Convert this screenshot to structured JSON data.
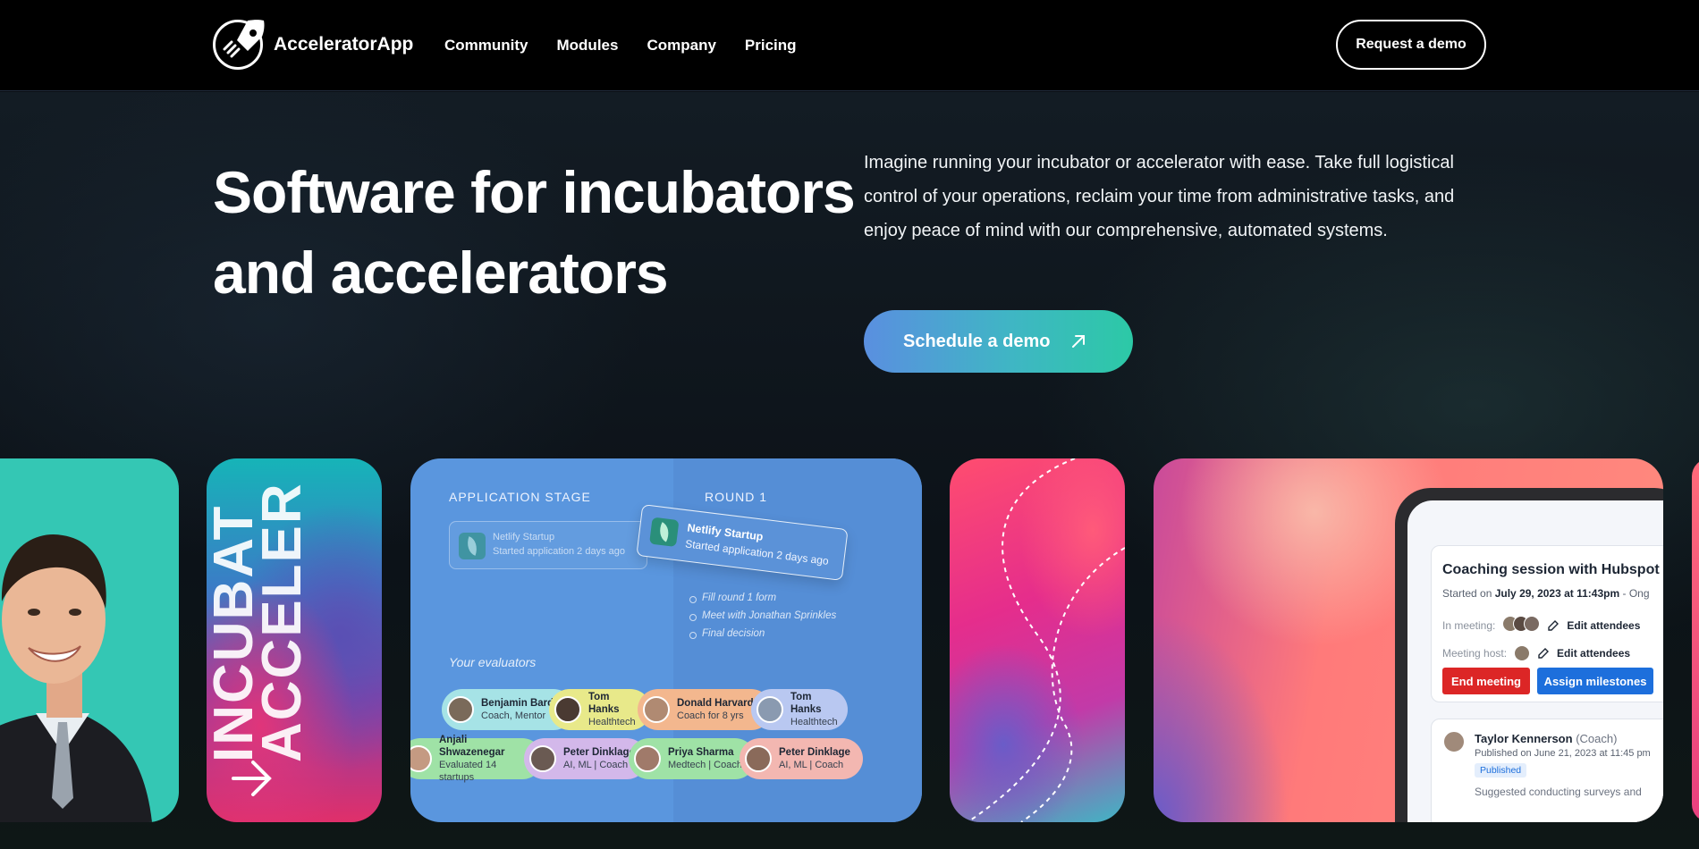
{
  "nav": {
    "brand": "AcceleratorApp",
    "links": [
      "Community",
      "Modules",
      "Company",
      "Pricing"
    ],
    "cta": "Request a demo"
  },
  "hero": {
    "title": "Software for incubators and accelerators",
    "description": "Imagine running your incubator or accelerator with ease. Take full logistical control of your operations, reclaim your time from administrative tasks, and enjoy peace of mind with our comprehensive, automated systems.",
    "cta": "Schedule a demo"
  },
  "cards": {
    "incubator": {
      "line1": "INCUBAT",
      "line2": "ACCELER"
    },
    "application": {
      "stage_label": "APPLICATION STAGE",
      "round_label": "ROUND 1",
      "tile_name": "Netlify Startup",
      "tile_sub": "Started application 2 days ago",
      "checklist": [
        "Fill round 1 form",
        "Meet with Jonathan Sprinkles",
        "Final decision"
      ],
      "evaluators_label": "Your evaluators",
      "evaluators": [
        {
          "name": "Benjamin Bard",
          "sub": "Coach, Mentor",
          "color": "#a6e3e6"
        },
        {
          "name": "Tom Hanks",
          "sub": "Healthtech",
          "color": "#e8e98a"
        },
        {
          "name": "Donald Harvard",
          "sub": "Coach for 8 yrs",
          "color": "#f3b78e"
        },
        {
          "name": "Tom Hanks",
          "sub": "Healthtech",
          "color": "#b9c8f1"
        },
        {
          "name": "Anjali Shwazenegar",
          "sub": "Evaluated 14 startups",
          "color": "#9fe2a6"
        },
        {
          "name": "Peter Dinklage",
          "sub": "AI, ML | Coach",
          "color": "#d3b8ea"
        },
        {
          "name": "Priya Sharma",
          "sub": "Medtech | Coach",
          "color": "#9fe2a6"
        },
        {
          "name": "Peter Dinklage",
          "sub": "AI, ML | Coach",
          "color": "#f3b7b1"
        }
      ]
    },
    "coaching": {
      "title": "Coaching session with Hubspot L",
      "started_prefix": "Started on",
      "started_date": "July 29, 2023 at 11:43pm",
      "started_suffix": "- Ong",
      "in_meeting_label": "In meeting:",
      "edit_attendees": "Edit attendees",
      "meeting_host_label": "Meeting host:",
      "end_meeting": "End meeting",
      "assign_milestones": "Assign milestones",
      "post_author": "Taylor Kennerson",
      "post_role": "(Coach)",
      "post_date": "Published on June 21, 2023 at 11:45 pm",
      "post_badge": "Published",
      "post_text": "Suggested conducting surveys and"
    }
  }
}
